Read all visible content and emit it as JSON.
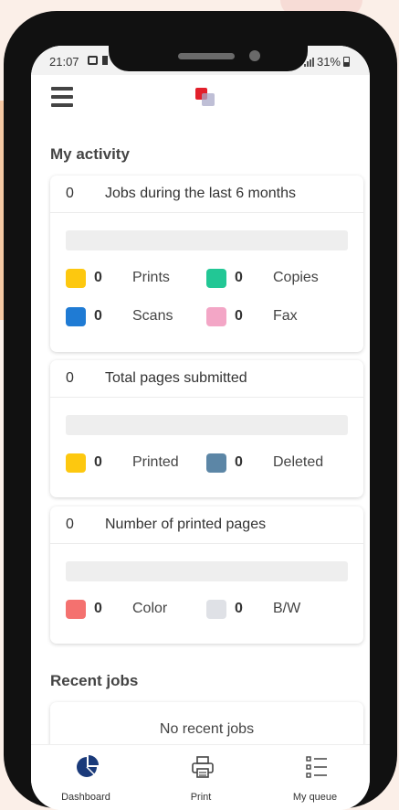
{
  "status_bar": {
    "time": "21:07",
    "battery": "31%"
  },
  "my_activity": {
    "title": "My activity",
    "cards": [
      {
        "count": "0",
        "title": "Jobs during the last 6 months",
        "rows": [
          [
            {
              "value": "0",
              "label": "Prints",
              "color": "#fdc80f"
            },
            {
              "value": "0",
              "label": "Copies",
              "color": "#22c795"
            }
          ],
          [
            {
              "value": "0",
              "label": "Scans",
              "color": "#1f7bd4"
            },
            {
              "value": "0",
              "label": "Fax",
              "color": "#f3a6c6"
            }
          ]
        ]
      },
      {
        "count": "0",
        "title": "Total pages submitted",
        "rows": [
          [
            {
              "value": "0",
              "label": "Printed",
              "color": "#fdc80f"
            },
            {
              "value": "0",
              "label": "Deleted",
              "color": "#5c86a6"
            }
          ]
        ]
      },
      {
        "count": "0",
        "title": "Number of printed pages",
        "rows": [
          [
            {
              "value": "0",
              "label": "Color",
              "color": "#f4716f"
            },
            {
              "value": "0",
              "label": "B/W",
              "color": "#dfe1e6"
            }
          ]
        ]
      }
    ]
  },
  "recent_jobs": {
    "title": "Recent jobs",
    "empty_text": "No recent jobs"
  },
  "bottom_nav": {
    "items": [
      {
        "label": "Dashboard",
        "icon": "pie-chart-icon",
        "active": true
      },
      {
        "label": "Print",
        "icon": "printer-icon",
        "active": false
      },
      {
        "label": "My queue",
        "icon": "queue-list-icon",
        "active": false
      }
    ],
    "accent": "#1a3a7a"
  }
}
